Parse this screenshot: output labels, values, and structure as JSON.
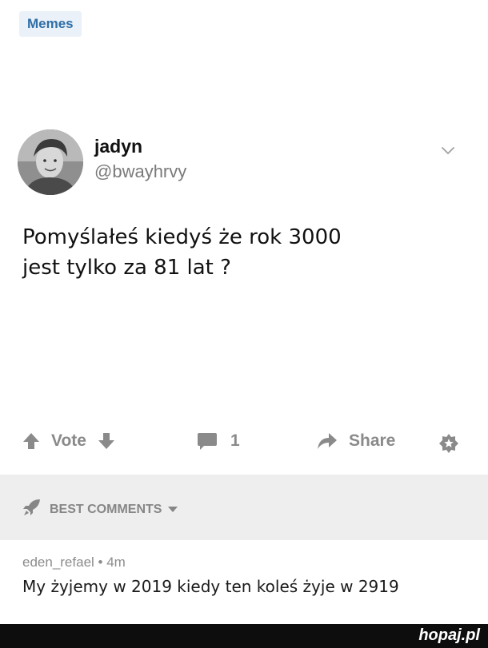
{
  "category_tag": "Memes",
  "tweet": {
    "name": "jadyn",
    "handle": "@bwayhrvy",
    "text_lines": [
      "Pomyślałeś kiedyś że rok 3000",
      "jest tylko za 81 lat ?"
    ]
  },
  "actions": {
    "vote_label": "Vote",
    "comment_count": "1",
    "share_label": "Share"
  },
  "comments_header": "BEST COMMENTS",
  "comment": {
    "author": "eden_refael",
    "separator": " • ",
    "age": "4m",
    "text": "My żyjemy w 2019 kiedy ten koleś żyje w 2919"
  },
  "watermark": "hopaj.pl",
  "colors": {
    "tag_bg": "#eaf1f8",
    "tag_text": "#2f6ea6",
    "muted": "#8a8a8a",
    "comments_bar_bg": "#eeeeee",
    "footer_bg": "#0d0d0d"
  }
}
